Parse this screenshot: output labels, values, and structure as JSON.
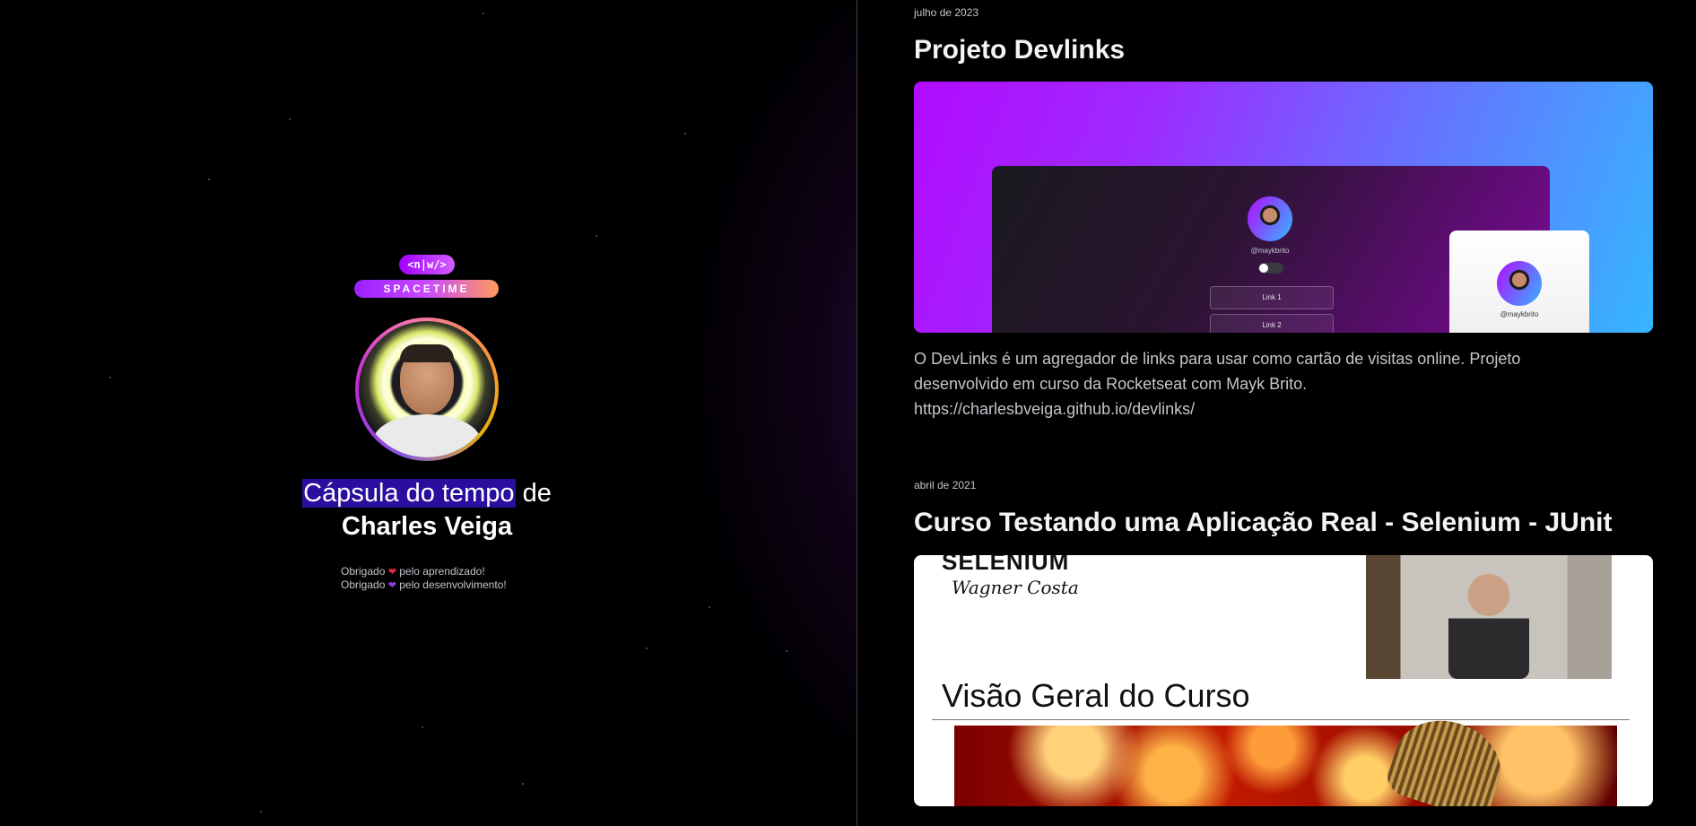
{
  "profile": {
    "logo_top": "<n|w/>",
    "logo_bottom": "SPACETIME",
    "title_highlight": "Cápsula do tempo",
    "title_rest": " de",
    "name": "Charles Veiga",
    "thanks_1_pre": "Obrigado ",
    "thanks_1_post": " pelo aprendizado!",
    "thanks_2_pre": "Obrigado ",
    "thanks_2_post": " pelo desenvolvimento!",
    "heart_1_color": "#e5253f",
    "heart_2_color": "#8b3fe0"
  },
  "memories": [
    {
      "date": "julho de 2023",
      "title": "Projeto Devlinks",
      "mock": {
        "handle": "@maykbrito",
        "link_1": "Link 1",
        "link_2": "Link 2",
        "mobile_handle": "@maykbrito"
      },
      "description_1": "O DevLinks é um agregador de links para usar como cartão de visitas online. Projeto desenvolvido em curso da Rocketseat com Mayk Brito.",
      "description_2": "https://charlesbveiga.github.io/devlinks/"
    },
    {
      "date": "abril de 2021",
      "title": "Curso Testando uma Aplicação Real - Selenium - JUnit",
      "slide": {
        "top_text": "SELENIUM",
        "author": "Wagner Costa",
        "heading": "Visão Geral do Curso"
      }
    }
  ],
  "colors": {
    "highlight": "#2a0f9e",
    "gradient_start": "#b20bff",
    "gradient_end": "#35b6ff"
  }
}
